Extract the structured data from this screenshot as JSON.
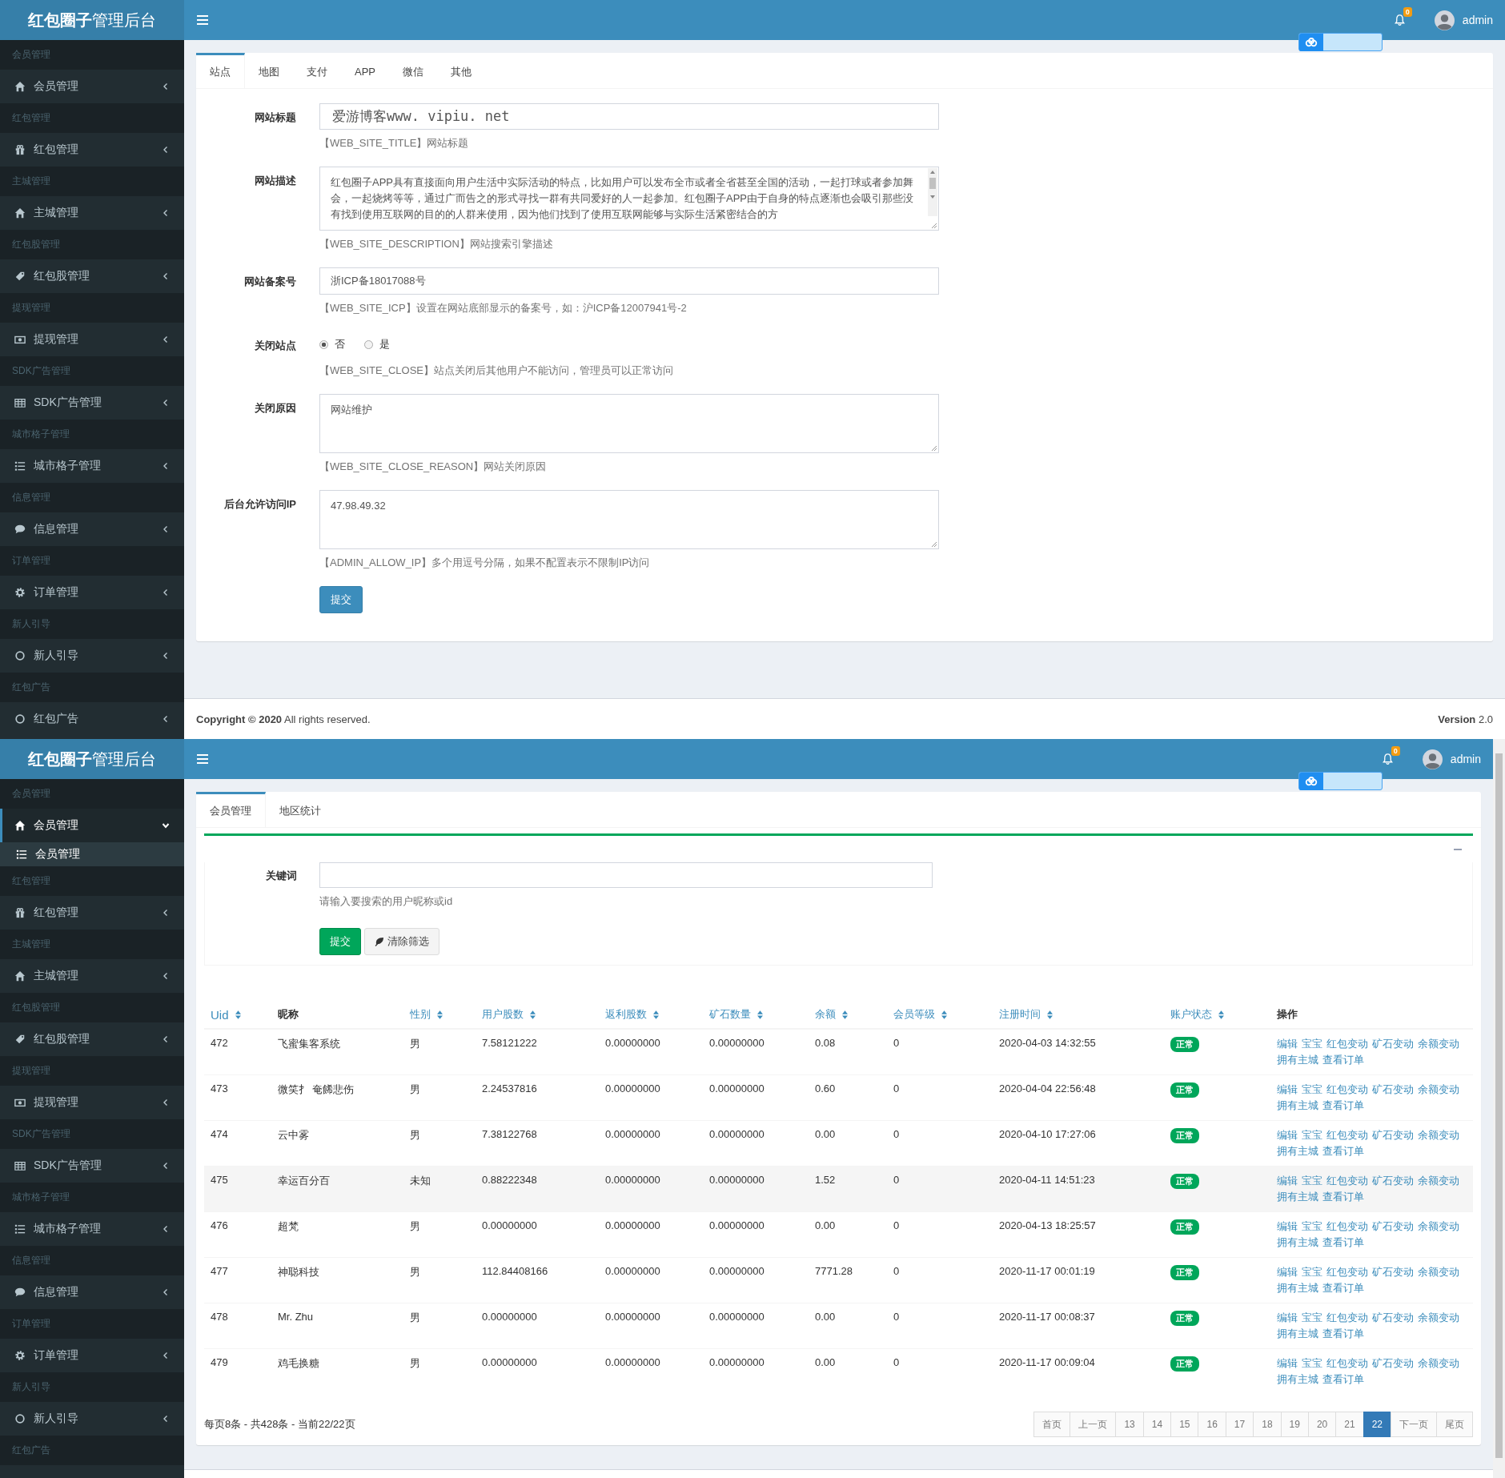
{
  "screens": [
    {
      "header": {
        "brand": "**红包圈子**管理后台",
        "notifications": "0",
        "user": "admin"
      },
      "sidebar": [
        {
          "section": "会员管理",
          "label": "会员管理",
          "kind": "home",
          "expanded": false
        },
        {
          "section": "红包管理",
          "label": "红包管理",
          "kind": "gift",
          "expanded": false
        },
        {
          "section": "主城管理",
          "label": "主城管理",
          "kind": "home",
          "expanded": false
        },
        {
          "section": "红包股管理",
          "label": "红包股管理",
          "kind": "tag",
          "expanded": false
        },
        {
          "section": "提现管理",
          "label": "提现管理",
          "kind": "money",
          "expanded": false
        },
        {
          "section": "SDK广告管理",
          "label": "SDK广告管理",
          "kind": "table",
          "expanded": false
        },
        {
          "section": "城市格子管理",
          "label": "城市格子管理",
          "kind": "list",
          "expanded": false
        },
        {
          "section": "信息管理",
          "label": "信息管理",
          "kind": "chat",
          "expanded": false
        },
        {
          "section": "订单管理",
          "label": "订单管理",
          "kind": "gear",
          "expanded": false
        },
        {
          "section": "新人引导",
          "label": "新人引导",
          "kind": "circle",
          "expanded": false
        },
        {
          "section": "红包广告",
          "label": "红包广告",
          "kind": "circle",
          "expanded": false
        }
      ],
      "page": {
        "kind": "settings",
        "tabs": [
          {
            "label": "站点",
            "selected": true
          },
          {
            "label": "地图",
            "selected": false
          },
          {
            "label": "支付",
            "selected": false
          },
          {
            "label": "APP",
            "selected": false
          },
          {
            "label": "微信",
            "selected": false
          },
          {
            "label": "其他",
            "selected": false
          }
        ],
        "fields": [
          {
            "kind": "headline",
            "label": "网站标题",
            "value": "爱游博客www. vipiu. net",
            "help": "【WEB_SITE_TITLE】网站标题"
          },
          {
            "kind": "textarea",
            "label": "网站描述",
            "scrollbar": true,
            "value": "红包圈子APP具有直接面向用户生活中实际活动的特点，比如用户可以发布全市或者全省甚至全国的活动，一起打球或者参加舞会，一起烧烤等等，通过广而告之的形式寻找一群有共同爱好的人一起参加。红包圈子APP由于自身的特点逐渐也会吸引那些没有找到使用互联网的目的的人群来使用，因为他们找到了使用互联网能够与实际生活紧密结合的方",
            "help": "【WEB_SITE_DESCRIPTION】网站搜索引擎描述"
          },
          {
            "kind": "input",
            "label": "网站备案号",
            "value": "浙ICP备18017088号",
            "help": "【WEB_SITE_ICP】设置在网站底部显示的备案号，如：沪ICP备12007941号-2"
          },
          {
            "kind": "radio",
            "label": "关闭站点",
            "options": [
              {
                "label": "否",
                "selected": true
              },
              {
                "label": "是",
                "selected": false
              }
            ],
            "help": "【WEB_SITE_CLOSE】站点关闭后其他用户不能访问，管理员可以正常访问"
          },
          {
            "kind": "textarea",
            "label": "关闭原因",
            "value": "网站维护",
            "help": "【WEB_SITE_CLOSE_REASON】网站关闭原因"
          },
          {
            "kind": "textarea",
            "label": "后台允许访问IP",
            "value": "47.98.49.32",
            "help": "【ADMIN_ALLOW_IP】多个用逗号分隔，如果不配置表示不限制IP访问"
          }
        ],
        "submit": "提交"
      },
      "footer": {
        "copyright": "**Copyright © 2020** All rights reserved.",
        "version": "**Version** 2.0"
      }
    },
    {
      "scrollbar": true,
      "header": {
        "brand": "**红包圈子**管理后台",
        "notifications": "0",
        "user": "admin"
      },
      "sidebar": [
        {
          "section": "会员管理",
          "label": "会员管理",
          "kind": "home",
          "expanded": true,
          "children": [
            {
              "label": "会员管理",
              "kind": "list",
              "selected": true
            }
          ]
        },
        {
          "section": "红包管理",
          "label": "红包管理",
          "kind": "gift",
          "expanded": false
        },
        {
          "section": "主城管理",
          "label": "主城管理",
          "kind": "home",
          "expanded": false
        },
        {
          "section": "红包股管理",
          "label": "红包股管理",
          "kind": "tag",
          "expanded": false
        },
        {
          "section": "提现管理",
          "label": "提现管理",
          "kind": "money",
          "expanded": false
        },
        {
          "section": "SDK广告管理",
          "label": "SDK广告管理",
          "kind": "table",
          "expanded": false
        },
        {
          "section": "城市格子管理",
          "label": "城市格子管理",
          "kind": "list",
          "expanded": false
        },
        {
          "section": "信息管理",
          "label": "信息管理",
          "kind": "chat",
          "expanded": false
        },
        {
          "section": "订单管理",
          "label": "订单管理",
          "kind": "gear",
          "expanded": false
        },
        {
          "section": "新人引导",
          "label": "新人引导",
          "kind": "circle",
          "expanded": false
        },
        {
          "section": "红包广告"
        }
      ],
      "page": {
        "kind": "list",
        "tabs": [
          {
            "label": "会员管理",
            "selected": true
          },
          {
            "label": "地区统计",
            "selected": false
          }
        ],
        "filter": {
          "label": "关键词",
          "help": "请输入要搜索的用户昵称或id",
          "submit": "提交",
          "clear": "清除筛选"
        },
        "table": {
          "columns": [
            {
              "label": "Uid",
              "sortable": true
            },
            {
              "label": "昵称",
              "sortable": false
            },
            {
              "label": "性别",
              "sortable": true
            },
            {
              "label": "用户股数",
              "sortable": true
            },
            {
              "label": "返利股数",
              "sortable": true
            },
            {
              "label": "矿石数量",
              "sortable": true
            },
            {
              "label": "余额",
              "sortable": true
            },
            {
              "label": "会员等级",
              "sortable": true
            },
            {
              "label": "注册时间",
              "sortable": true
            },
            {
              "label": "账户状态",
              "sortable": true
            },
            {
              "label": "操作",
              "sortable": false
            }
          ],
          "rows": [
            {
              "selected": false,
              "cells": [
                "472",
                "飞蜜集客系统",
                "男",
                "7.58121222",
                "0.00000000",
                "0.00000000",
                "0.08",
                "0",
                "2020-04-03 14:32:55"
              ],
              "status": "正常",
              "actions": [
                "编辑",
                "宝宝",
                "红包变动",
                "矿石变动",
                "余额变动",
                "拥有主城",
                "查看订单"
              ]
            },
            {
              "selected": false,
              "cells": [
                "473",
                "微笑扌 奄餙悲伤",
                "男",
                "2.24537816",
                "0.00000000",
                "0.00000000",
                "0.60",
                "0",
                "2020-04-04 22:56:48"
              ],
              "status": "正常",
              "actions": [
                "编辑",
                "宝宝",
                "红包变动",
                "矿石变动",
                "余额变动",
                "拥有主城",
                "查看订单"
              ]
            },
            {
              "selected": false,
              "cells": [
                "474",
                "云中雾",
                "男",
                "7.38122768",
                "0.00000000",
                "0.00000000",
                "0.00",
                "0",
                "2020-04-10 17:27:06"
              ],
              "status": "正常",
              "actions": [
                "编辑",
                "宝宝",
                "红包变动",
                "矿石变动",
                "余额变动",
                "拥有主城",
                "查看订单"
              ]
            },
            {
              "selected": true,
              "cells": [
                "475",
                "幸运百分百",
                "未知",
                "0.88222348",
                "0.00000000",
                "0.00000000",
                "1.52",
                "0",
                "2020-04-11 14:51:23"
              ],
              "status": "正常",
              "actions": [
                "编辑",
                "宝宝",
                "红包变动",
                "矿石变动",
                "余额变动",
                "拥有主城",
                "查看订单"
              ]
            },
            {
              "selected": false,
              "cells": [
                "476",
                "超梵",
                "男",
                "0.00000000",
                "0.00000000",
                "0.00000000",
                "0.00",
                "0",
                "2020-04-13 18:25:57"
              ],
              "status": "正常",
              "actions": [
                "编辑",
                "宝宝",
                "红包变动",
                "矿石变动",
                "余额变动",
                "拥有主城",
                "查看订单"
              ]
            },
            {
              "selected": false,
              "cells": [
                "477",
                "神聪科技",
                "男",
                "112.84408166",
                "0.00000000",
                "0.00000000",
                "7771.28",
                "0",
                "2020-11-17 00:01:19"
              ],
              "status": "正常",
              "actions": [
                "编辑",
                "宝宝",
                "红包变动",
                "矿石变动",
                "余额变动",
                "拥有主城",
                "查看订单"
              ]
            },
            {
              "selected": false,
              "cells": [
                "478",
                "Mr. Zhu",
                "男",
                "0.00000000",
                "0.00000000",
                "0.00000000",
                "0.00",
                "0",
                "2020-11-17 00:08:37"
              ],
              "status": "正常",
              "actions": [
                "编辑",
                "宝宝",
                "红包变动",
                "矿石变动",
                "余额变动",
                "拥有主城",
                "查看订单"
              ]
            },
            {
              "selected": false,
              "cells": [
                "479",
                "鸡毛换糖",
                "男",
                "0.00000000",
                "0.00000000",
                "0.00000000",
                "0.00",
                "0",
                "2020-11-17 00:09:04"
              ],
              "status": "正常",
              "actions": [
                "编辑",
                "宝宝",
                "红包变动",
                "矿石变动",
                "余额变动",
                "拥有主城",
                "查看订单"
              ]
            }
          ]
        },
        "pagination": {
          "summary": "每页8条 - 共428条 - 当前22/22页",
          "pages": [
            {
              "label": "首页",
              "selected": false
            },
            {
              "label": "上一页",
              "selected": false
            },
            {
              "label": "13",
              "selected": false
            },
            {
              "label": "14",
              "selected": false
            },
            {
              "label": "15",
              "selected": false
            },
            {
              "label": "16",
              "selected": false
            },
            {
              "label": "17",
              "selected": false
            },
            {
              "label": "18",
              "selected": false
            },
            {
              "label": "19",
              "selected": false
            },
            {
              "label": "20",
              "selected": false
            },
            {
              "label": "21",
              "selected": false
            },
            {
              "label": "22",
              "selected": true
            },
            {
              "label": "下一页",
              "selected": false
            },
            {
              "label": "尾页",
              "selected": false
            }
          ]
        }
      }
    }
  ]
}
